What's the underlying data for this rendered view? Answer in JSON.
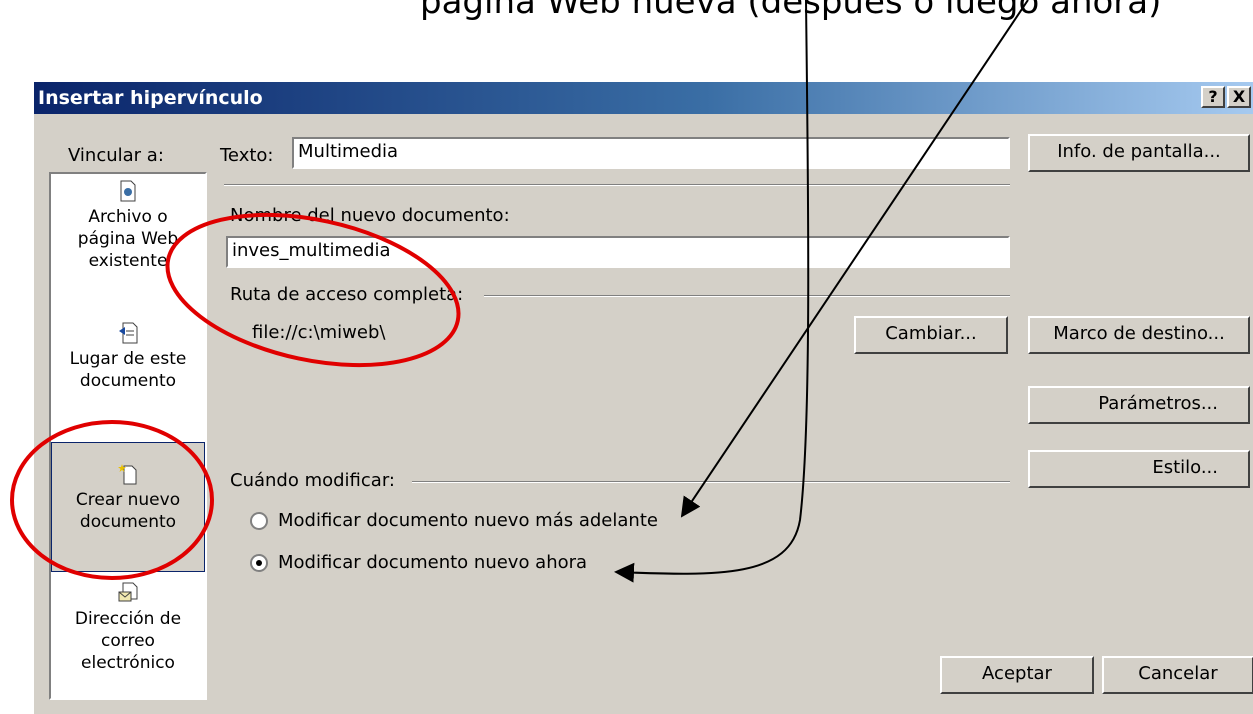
{
  "caption": "página Web nueva (después o luego ahora)",
  "dialog": {
    "title": "Insertar hipervínculo",
    "help_button": "?",
    "close_button": "X",
    "link_to_label": "Vincular a:",
    "text_label": "Texto:",
    "text_value": "Multimedia",
    "screentip_button": "Info. de pantalla...",
    "new_doc_name_label": "Nombre del nuevo documento:",
    "new_doc_name_value": "inves_multimedia",
    "full_path_label": "Ruta de acceso completa:",
    "full_path_value": "file://c:\\miweb\\",
    "change_button": "Cambiar...",
    "target_frame_button": "Marco de destino...",
    "parameters_button": "Parámetros...",
    "style_button": "Estilo...",
    "when_edit_label": "Cuándo modificar:",
    "radio_later": "Modificar documento nuevo más adelante",
    "radio_now": "Modificar documento nuevo ahora",
    "selected_radio": "now",
    "ok_button": "Aceptar",
    "cancel_button": "Cancelar"
  },
  "sidebar": {
    "items": [
      {
        "label1": "Archivo o",
        "label2": "página Web",
        "label3": "existente",
        "icon": "web-page-icon"
      },
      {
        "label1": "Lugar de este",
        "label2": "documento",
        "icon": "place-in-document-icon"
      },
      {
        "label1": "Crear nuevo",
        "label2": "documento",
        "icon": "new-document-icon",
        "selected": true
      },
      {
        "label1": "Dirección de",
        "label2": "correo",
        "label3": "electrónico",
        "icon": "email-icon"
      }
    ]
  },
  "annotations": {
    "color": "#e00000",
    "line_color": "#000000"
  }
}
